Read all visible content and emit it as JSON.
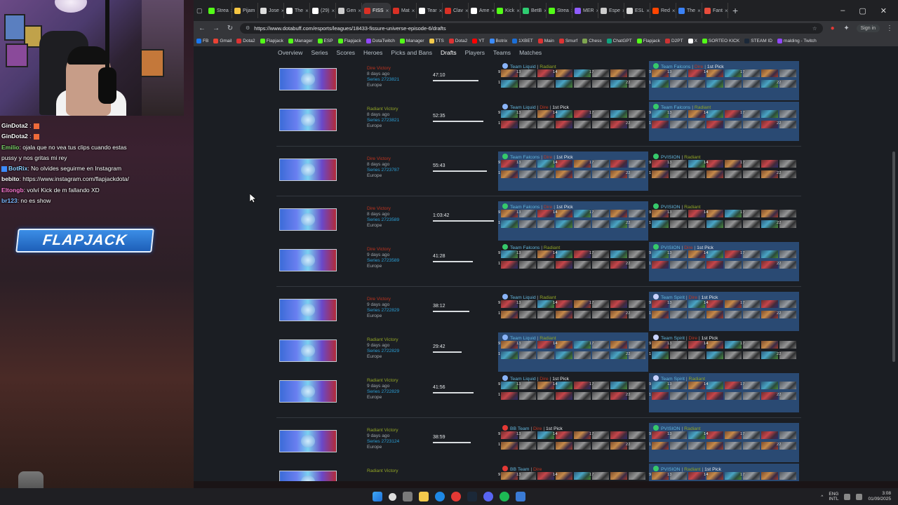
{
  "chat": [
    {
      "user": "GinDota2",
      "text": " :",
      "user_color": "#ffffff",
      "badge": true
    },
    {
      "user": "GinDota2",
      "text": " :",
      "user_color": "#ffffff",
      "badge": true
    },
    {
      "user": "Emilio",
      "text": ": ojala que no vea tus clips cuando estas",
      "user_color": "#7cd36a"
    },
    {
      "user": "",
      "text": "pussy y nos gritas mi rey",
      "user_color": "#ffffff"
    },
    {
      "user": "BotRix",
      "text": ": No olvides seguirme en Instagram",
      "user_color": "#8ad0ff",
      "blue_badge": true
    },
    {
      "user": "bebito",
      "text": ": https://www.instagram.com/flapjackdota/",
      "user_color": "#ffffff"
    },
    {
      "user": "Eltongb",
      "text": ": volví Kick de m fallando XD",
      "user_color": "#ff7ad5"
    },
    {
      "user": "br123",
      "text": ": no es show",
      "user_color": "#7ab8ff"
    }
  ],
  "overlay_logo": "FLAPJACK",
  "browser": {
    "tabs": [
      {
        "label": "Strea",
        "color": "#53fc18"
      },
      {
        "label": "Pijam",
        "color": "#f4c542"
      },
      {
        "label": "Jose",
        "color": "#dddddd"
      },
      {
        "label": "The",
        "color": "#ffffff"
      },
      {
        "label": "(29)",
        "color": "#ffffff"
      },
      {
        "label": "Gen",
        "color": "#cccccc"
      },
      {
        "label": "FISS",
        "color": "#d93025",
        "active": true
      },
      {
        "label": "Mat",
        "color": "#d93025"
      },
      {
        "label": "Tear",
        "color": "#ffffff"
      },
      {
        "label": "Clav",
        "color": "#d93025"
      },
      {
        "label": "Ame",
        "color": "#ffffff"
      },
      {
        "label": "Kick",
        "color": "#53fc18"
      },
      {
        "label": "BetB",
        "color": "#2ecc71"
      },
      {
        "label": "Strea",
        "color": "#53fc18"
      },
      {
        "label": "MER",
        "color": "#8f5cff"
      },
      {
        "label": "Espe",
        "color": "#cccccc"
      },
      {
        "label": "ESL",
        "color": "#dddddd"
      },
      {
        "label": "Red",
        "color": "#ff4500"
      },
      {
        "label": "The",
        "color": "#3b82f6"
      },
      {
        "label": "Fant",
        "color": "#e74c3c"
      }
    ],
    "url": "https://www.dotabuff.com/esports/leagues/18433-fissure-universe-episode-6/drafts",
    "sign_in": "Sign in",
    "bookmarks": [
      {
        "label": "FB",
        "color": "#1877f2"
      },
      {
        "label": "Gmail",
        "color": "#ea4335"
      },
      {
        "label": "Dota2",
        "color": "#d33"
      },
      {
        "label": "Flapjack",
        "color": "#53fc18"
      },
      {
        "label": "Manager",
        "color": "#53fc18"
      },
      {
        "label": "ESP",
        "color": "#53fc18"
      },
      {
        "label": "Flapjack",
        "color": "#53fc18"
      },
      {
        "label": "DotaTwitch",
        "color": "#9147ff"
      },
      {
        "label": "Manager",
        "color": "#53fc18"
      },
      {
        "label": "TTS",
        "color": "#f2c94c"
      },
      {
        "label": "Dota2",
        "color": "#d33"
      },
      {
        "label": "YT",
        "color": "#ff0000"
      },
      {
        "label": "Botrix",
        "color": "#3c8cff"
      },
      {
        "label": "1XBET",
        "color": "#1b6fd8"
      },
      {
        "label": "Main",
        "color": "#d33"
      },
      {
        "label": "Smurf",
        "color": "#d33"
      },
      {
        "label": "Chess",
        "color": "#7fa650"
      },
      {
        "label": "ChatGPT",
        "color": "#10a37f"
      },
      {
        "label": "Flapjack",
        "color": "#53fc18"
      },
      {
        "label": "D2PT",
        "color": "#c33"
      },
      {
        "label": "X",
        "color": "#ffffff"
      },
      {
        "label": "SORTEO KICK",
        "color": "#53fc18"
      },
      {
        "label": "STEAM ID",
        "color": "#1b2838"
      },
      {
        "label": "malding - Twitch",
        "color": "#9147ff"
      }
    ]
  },
  "subnav": [
    "Overview",
    "Series",
    "Scores",
    "Heroes",
    "Picks and Bans",
    "Drafts",
    "Players",
    "Teams",
    "Matches"
  ],
  "subnav_active": "Drafts",
  "matches": [
    {
      "result": "Dire Victory",
      "result_side": "dire",
      "ago": "8 days ago",
      "series": "Series 2723821",
      "region": "Europe",
      "duration": "47:10",
      "duration_fraction": 0.72,
      "t1": {
        "name": "Team Liquid",
        "side": "Radiant",
        "first_pick": false,
        "highlight": false,
        "logo": "#8ab4f8"
      },
      "t2": {
        "name": "Team Falcons",
        "side": "Dire",
        "first_pick": true,
        "highlight": true,
        "logo": "#36c96b"
      }
    },
    {
      "result": "Radiant Victory",
      "result_side": "rad",
      "ago": "8 days ago",
      "series": "Series 2723821",
      "region": "Europe",
      "duration": "52:35",
      "duration_fraction": 0.8,
      "t1": {
        "name": "Team Liquid",
        "side": "Dire",
        "first_pick": true,
        "highlight": false,
        "logo": "#8ab4f8"
      },
      "t2": {
        "name": "Team Falcons",
        "side": "Radiant",
        "first_pick": false,
        "highlight": true,
        "logo": "#36c96b"
      }
    },
    {
      "result": "Dire Victory",
      "result_side": "dire",
      "ago": "8 days ago",
      "series": "Series 2723787",
      "region": "Europe",
      "duration": "55:43",
      "duration_fraction": 0.85,
      "gap": true,
      "t1": {
        "name": "Team Falcons",
        "side": "Dire",
        "first_pick": true,
        "highlight": true,
        "logo": "#36c96b"
      },
      "t2": {
        "name": "PVISION",
        "side": "Radiant",
        "first_pick": false,
        "highlight": false,
        "logo": "#36c96b"
      }
    },
    {
      "result": "Dire Victory",
      "result_side": "dire",
      "ago": "8 days ago",
      "series": "Series 2723589",
      "region": "Europe",
      "duration": "1:03:42",
      "duration_fraction": 0.97,
      "gap": true,
      "t1": {
        "name": "Team Falcons",
        "side": "Dire",
        "first_pick": true,
        "highlight": true,
        "logo": "#36c96b"
      },
      "t2": {
        "name": "PVISION",
        "side": "Radiant",
        "first_pick": false,
        "highlight": false,
        "logo": "#36c96b"
      }
    },
    {
      "result": "Dire Victory",
      "result_side": "dire",
      "ago": "9 days ago",
      "series": "Series 2723589",
      "region": "Europe",
      "duration": "41:28",
      "duration_fraction": 0.63,
      "t1": {
        "name": "Team Falcons",
        "side": "Radiant",
        "first_pick": false,
        "highlight": false,
        "logo": "#36c96b"
      },
      "t2": {
        "name": "PVISION",
        "side": "Dire",
        "first_pick": true,
        "highlight": true,
        "logo": "#36c96b"
      }
    },
    {
      "result": "Dire Victory",
      "result_side": "dire",
      "ago": "9 days ago",
      "series": "Series 2722829",
      "region": "Europe",
      "duration": "38:12",
      "duration_fraction": 0.58,
      "gap": true,
      "t1": {
        "name": "Team Liquid",
        "side": "Radiant",
        "first_pick": false,
        "highlight": false,
        "logo": "#8ab4f8"
      },
      "t2": {
        "name": "Team Spirit",
        "side": "Dire",
        "first_pick": true,
        "highlight": true,
        "logo": "#c9d3ff"
      }
    },
    {
      "result": "Radiant Victory",
      "result_side": "rad",
      "ago": "9 days ago",
      "series": "Series 2722829",
      "region": "Europe",
      "duration": "29:42",
      "duration_fraction": 0.45,
      "t1": {
        "name": "Team Liquid",
        "side": "Radiant",
        "first_pick": false,
        "highlight": true,
        "logo": "#8ab4f8"
      },
      "t2": {
        "name": "Team Spirit",
        "side": "Dire",
        "first_pick": true,
        "highlight": false,
        "logo": "#c9d3ff"
      }
    },
    {
      "result": "Radiant Victory",
      "result_side": "rad",
      "ago": "9 days ago",
      "series": "Series 2722829",
      "region": "Europe",
      "duration": "41:56",
      "duration_fraction": 0.64,
      "t1": {
        "name": "Team Liquid",
        "side": "Dire",
        "first_pick": true,
        "highlight": false,
        "logo": "#8ab4f8"
      },
      "t2": {
        "name": "Team Spirit",
        "side": "Radiant",
        "first_pick": false,
        "highlight": true,
        "logo": "#c9d3ff"
      }
    },
    {
      "result": "Radiant Victory",
      "result_side": "rad",
      "ago": "9 days ago",
      "series": "Series 2723124",
      "region": "Europe",
      "duration": "38:59",
      "duration_fraction": 0.6,
      "gap": true,
      "t1": {
        "name": "BB Team",
        "side": "Dire",
        "first_pick": true,
        "highlight": false,
        "logo": "#e53935"
      },
      "t2": {
        "name": "PVISION",
        "side": "Radiant",
        "first_pick": false,
        "highlight": true,
        "logo": "#36c96b"
      }
    },
    {
      "result": "Radiant Victory",
      "result_side": "rad",
      "ago": "",
      "series": "",
      "region": "",
      "duration": "",
      "duration_fraction": 0,
      "t1": {
        "name": "BB Team",
        "side": "Dire",
        "first_pick": false,
        "highlight": false,
        "logo": "#e53935"
      },
      "t2": {
        "name": "PVISION",
        "side": "Radiant",
        "first_pick": true,
        "highlight": true,
        "logo": "#36c96b"
      }
    }
  ],
  "hero_numbers_row1": [
    "9",
    "13",
    "",
    "14",
    "",
    "17",
    "",
    ""
  ],
  "hero_numbers_row2": [
    "1",
    "",
    "",
    "",
    "",
    "",
    "",
    "22"
  ],
  "first_pick_label": "1st Pick",
  "taskbar": {
    "lang": "ENG",
    "lang2": "INTL",
    "time": "3:08",
    "date": "01/09/2025"
  }
}
